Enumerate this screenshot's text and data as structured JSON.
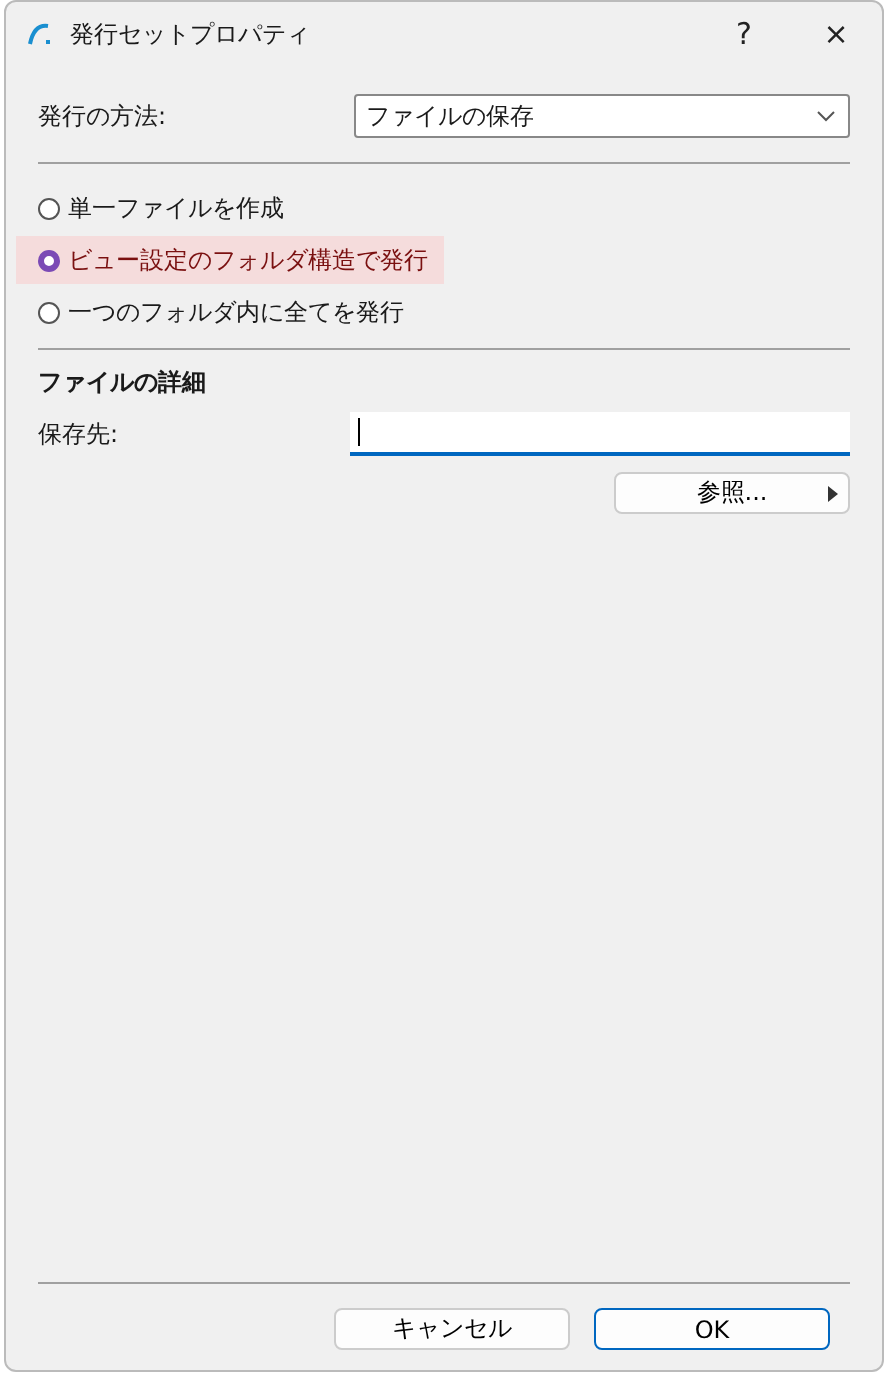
{
  "window": {
    "title": "発行セットプロパティ"
  },
  "title_buttons": [
    "?",
    "×"
  ],
  "method": {
    "label": "発行の方法:",
    "value": "ファイルの保存"
  },
  "options": [
    {
      "label": "単一ファイルを作成",
      "selected": false
    },
    {
      "label": "ビュー設定のフォルダ構造で発行",
      "selected": true
    },
    {
      "label": "一つのフォルダ内に全てを発行",
      "selected": false
    }
  ],
  "details": {
    "heading": "ファイルの詳細",
    "destination_label": "保存先:",
    "browse_button": "参照..."
  },
  "buttons": [
    {
      "label": "キャンセル",
      "default": false
    },
    {
      "label": "OK",
      "default": true
    }
  ]
}
